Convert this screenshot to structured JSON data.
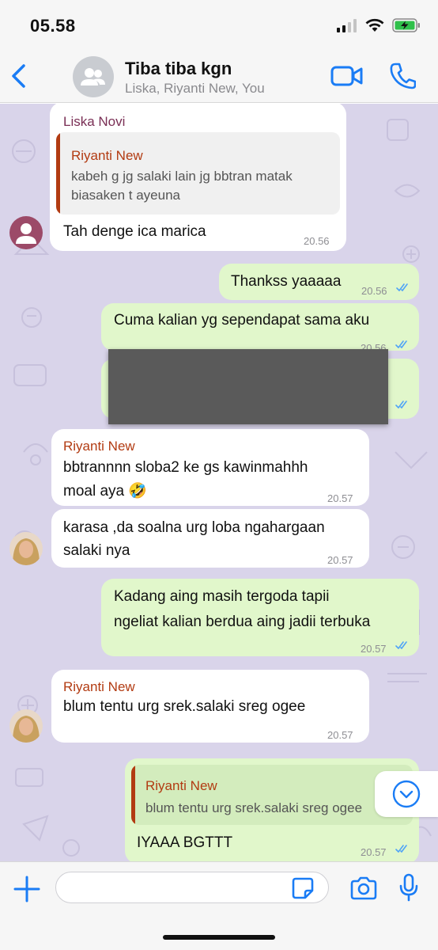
{
  "status_bar": {
    "time": "05.58"
  },
  "header": {
    "title": "Tiba tiba kgn",
    "subtitle": "Liska, Riyanti New, You"
  },
  "colors": {
    "accent": "#1a7cf5",
    "outgoing_bubble": "#e1f7cb",
    "incoming_bubble": "#ffffff",
    "chat_background": "#d9d4ea",
    "sender_liska": "#7a2f55",
    "sender_riyanti": "#b23b12"
  },
  "messages": [
    {
      "direction": "incoming",
      "sender": "Liska Novi",
      "quote": {
        "name": "Riyanti New",
        "text": "kabeh g jg salaki lain jg bbtran matak\nbiasaken t ayeuna"
      },
      "text": "Tah denge ica marica",
      "time": "20.56"
    },
    {
      "direction": "outgoing",
      "text": "Thankss yaaaaa",
      "time": "20.56"
    },
    {
      "direction": "outgoing",
      "text": "Cuma kalian yg sependapat sama aku",
      "time": "20.56"
    },
    {
      "direction": "outgoing",
      "text": "",
      "time": "",
      "redacted": true
    },
    {
      "direction": "incoming",
      "sender": "Riyanti New",
      "text": "bbtrannnn sloba2 ke gs kawinmahhh\nmoal aya 🤣",
      "time": "20.57"
    },
    {
      "direction": "incoming",
      "text": "karasa ,da soalna urg loba ngahargaan\nsalaki nya",
      "time": "20.57"
    },
    {
      "direction": "outgoing",
      "text": "Kadang aing masih tergoda tapii\nngeliat kalian berdua aing jadii terbuka",
      "time": "20.57"
    },
    {
      "direction": "incoming",
      "sender": "Riyanti New",
      "text": "blum tentu urg srek.salaki sreg ogee",
      "time": "20.57"
    },
    {
      "direction": "outgoing",
      "quote": {
        "name": "Riyanti New",
        "text": "blum tentu urg srek.salaki sreg ogee"
      },
      "text": "IYAAA BGTTT",
      "time": "20.57"
    }
  ],
  "input": {
    "placeholder": ""
  },
  "icons": {
    "back": "chevron-left-icon",
    "group": "group-avatar-icon",
    "video": "video-camera-icon",
    "call": "phone-icon",
    "add": "plus-icon",
    "sticker": "sticker-icon",
    "camera": "camera-icon",
    "mic": "microphone-icon",
    "scroll": "chevron-down-circle-icon"
  }
}
